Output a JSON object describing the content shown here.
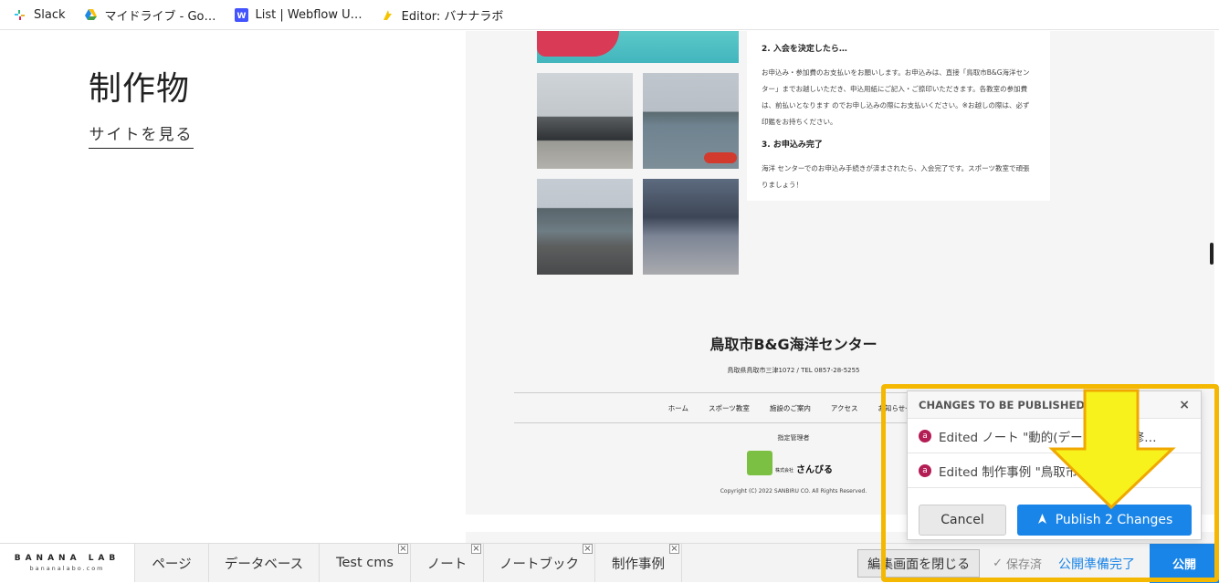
{
  "bookmarks": [
    {
      "label": "Slack",
      "icon": "slack-icon"
    },
    {
      "label": "マイドライブ - Go…",
      "icon": "google-drive-icon"
    },
    {
      "label": "List | Webflow U…",
      "icon": "webflow-icon"
    },
    {
      "label": "Editor: バナナラボ",
      "icon": "editor-icon"
    }
  ],
  "left": {
    "title": "制作物",
    "view_site": "サイトを見る"
  },
  "preview": {
    "card": {
      "heading2": "2. 入会を決定したら…",
      "body2": "お申込み・参加費のお支払いをお願いします。お申込みは、直接「鳥取市B&G海洋センター」までお越しいただき、申込用紙にご記入・ご捺印いただきます。各教室の参加費は、前払いとなります のでお申し込みの際にお支払いください。※お越しの際は、必ず印鑑をお持ちください。",
      "heading3": "3. お申込み完了",
      "body3": "海洋 センターでのお申込み手続きが済まされたら、入会完了です。スポーツ教室で頑張りましょう！"
    },
    "footer": {
      "title": "鳥取市B&G海洋センター",
      "address": "鳥取県鳥取市三津1072 / TEL 0857-28-5255",
      "nav": [
        "ホーム",
        "スポーツ教室",
        "施設のご案内",
        "アクセス",
        "お知らせ一覧"
      ],
      "manager": "指定管理者",
      "logo_small": "株式会社",
      "logo_name": "さんびる",
      "copyright": "Copyright (C) 2022 SANBIRU CO. All Rights Reserved."
    }
  },
  "toolbar": {
    "brand": "BANANA LAB",
    "brand_sub": "bananalabo.com",
    "tabs": [
      {
        "label": "ページ",
        "closable": false
      },
      {
        "label": "データベース",
        "closable": false
      },
      {
        "label": "Test cms",
        "closable": true
      },
      {
        "label": "ノート",
        "closable": true
      },
      {
        "label": "ノートブック",
        "closable": true
      },
      {
        "label": "制作事例",
        "closable": true
      }
    ],
    "close_editor": "編集画面を閉じる",
    "saved": "保存済",
    "publish_ready": "公開準備完了",
    "publish": "公開"
  },
  "popover": {
    "title": "CHANGES TO BE PUBLISHED:",
    "items": [
      "Edited ノート \"動的(データ…ジの修…",
      "Edited 制作事例 \"鳥取市B…ー\""
    ],
    "badge": "a",
    "cancel": "Cancel",
    "publish": "Publish 2 Changes"
  },
  "colors": {
    "accent": "#1a85e8",
    "highlight": "#f5b800",
    "arrow": "#f7f21c",
    "badge": "#b31d54"
  }
}
